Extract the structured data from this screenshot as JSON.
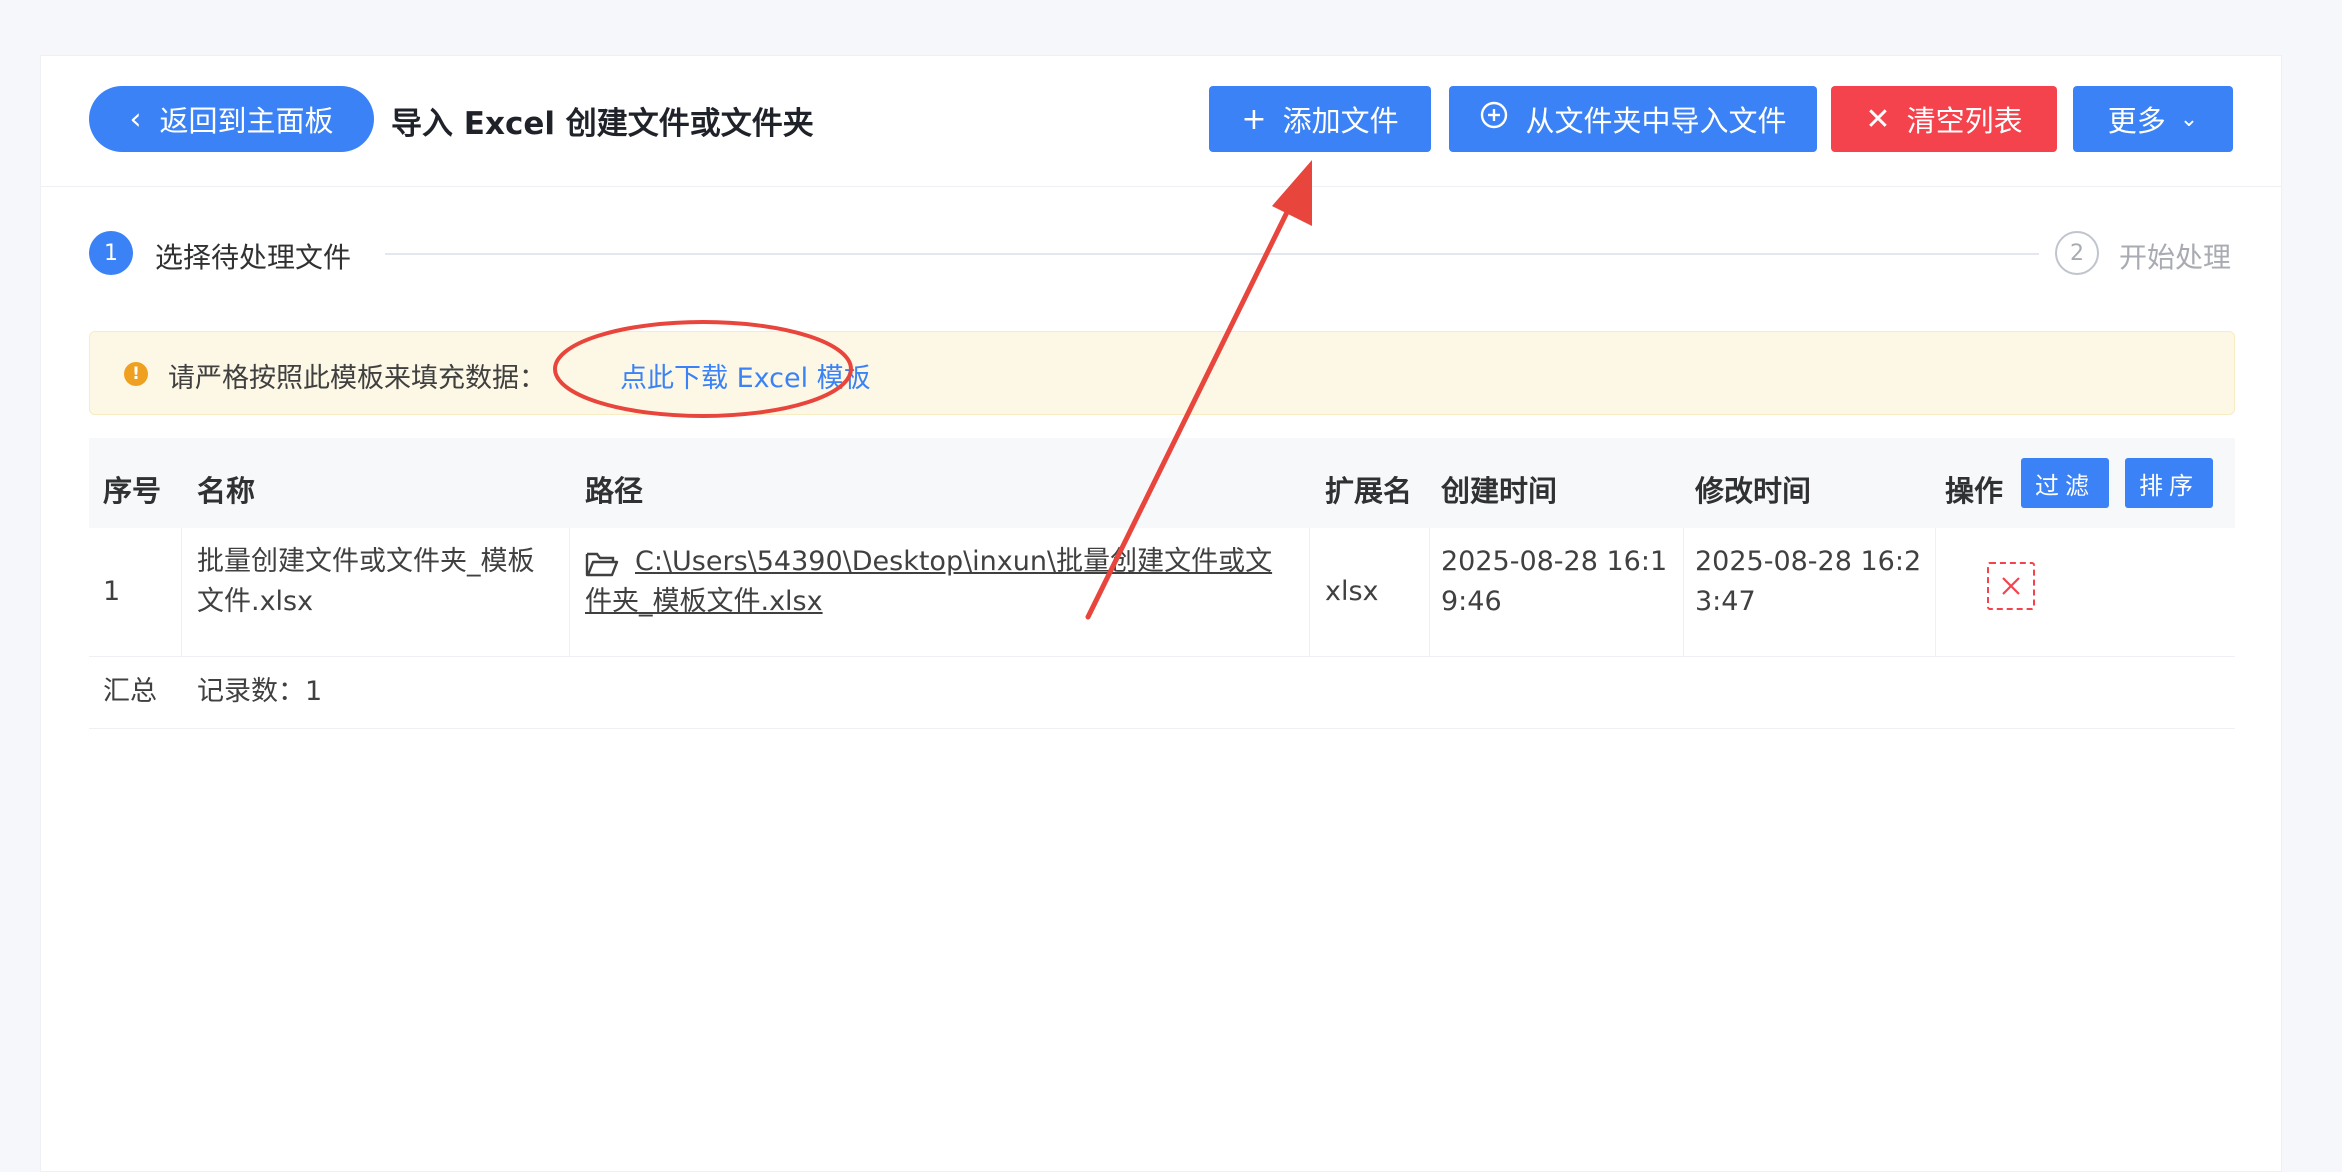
{
  "toolbar": {
    "back_label": "返回到主面板",
    "page_title": "导入 Excel 创建文件或文件夹",
    "add_file_label": "添加文件",
    "import_folder_label": "从文件夹中导入文件",
    "clear_list_label": "清空列表",
    "more_label": "更多"
  },
  "steps": [
    {
      "number": "1",
      "label": "选择待处理文件",
      "active": true
    },
    {
      "number": "2",
      "label": "开始处理",
      "active": false
    }
  ],
  "notice": {
    "text": "请严格按照此模板来填充数据：",
    "link": "点此下载 Excel 模板"
  },
  "table": {
    "headers": {
      "index": "序号",
      "name": "名称",
      "path": "路径",
      "ext": "扩展名",
      "created": "创建时间",
      "modified": "修改时间",
      "action": "操作"
    },
    "filter_label": "过滤",
    "sort_label": "排序",
    "rows": [
      {
        "index": "1",
        "name_line1": "批量创建文件或文件夹_模板",
        "name_line2": "文件.xlsx",
        "path_line1": "C:\\Users\\54390\\Desktop\\inxun\\批量创建文件或文",
        "path_line2": "件夹_模板文件.xlsx",
        "ext": "xlsx",
        "created_line1": "2025-08-28 16:1",
        "created_line2": "9:46",
        "modified_line1": "2025-08-28 16:2",
        "modified_line2": "3:47"
      }
    ],
    "footer": {
      "label": "汇总",
      "count": "记录数：1"
    }
  },
  "colors": {
    "primary": "#3b82f6",
    "danger": "#f4434c",
    "warning": "#f0a020",
    "annotation": "#e8453c"
  }
}
